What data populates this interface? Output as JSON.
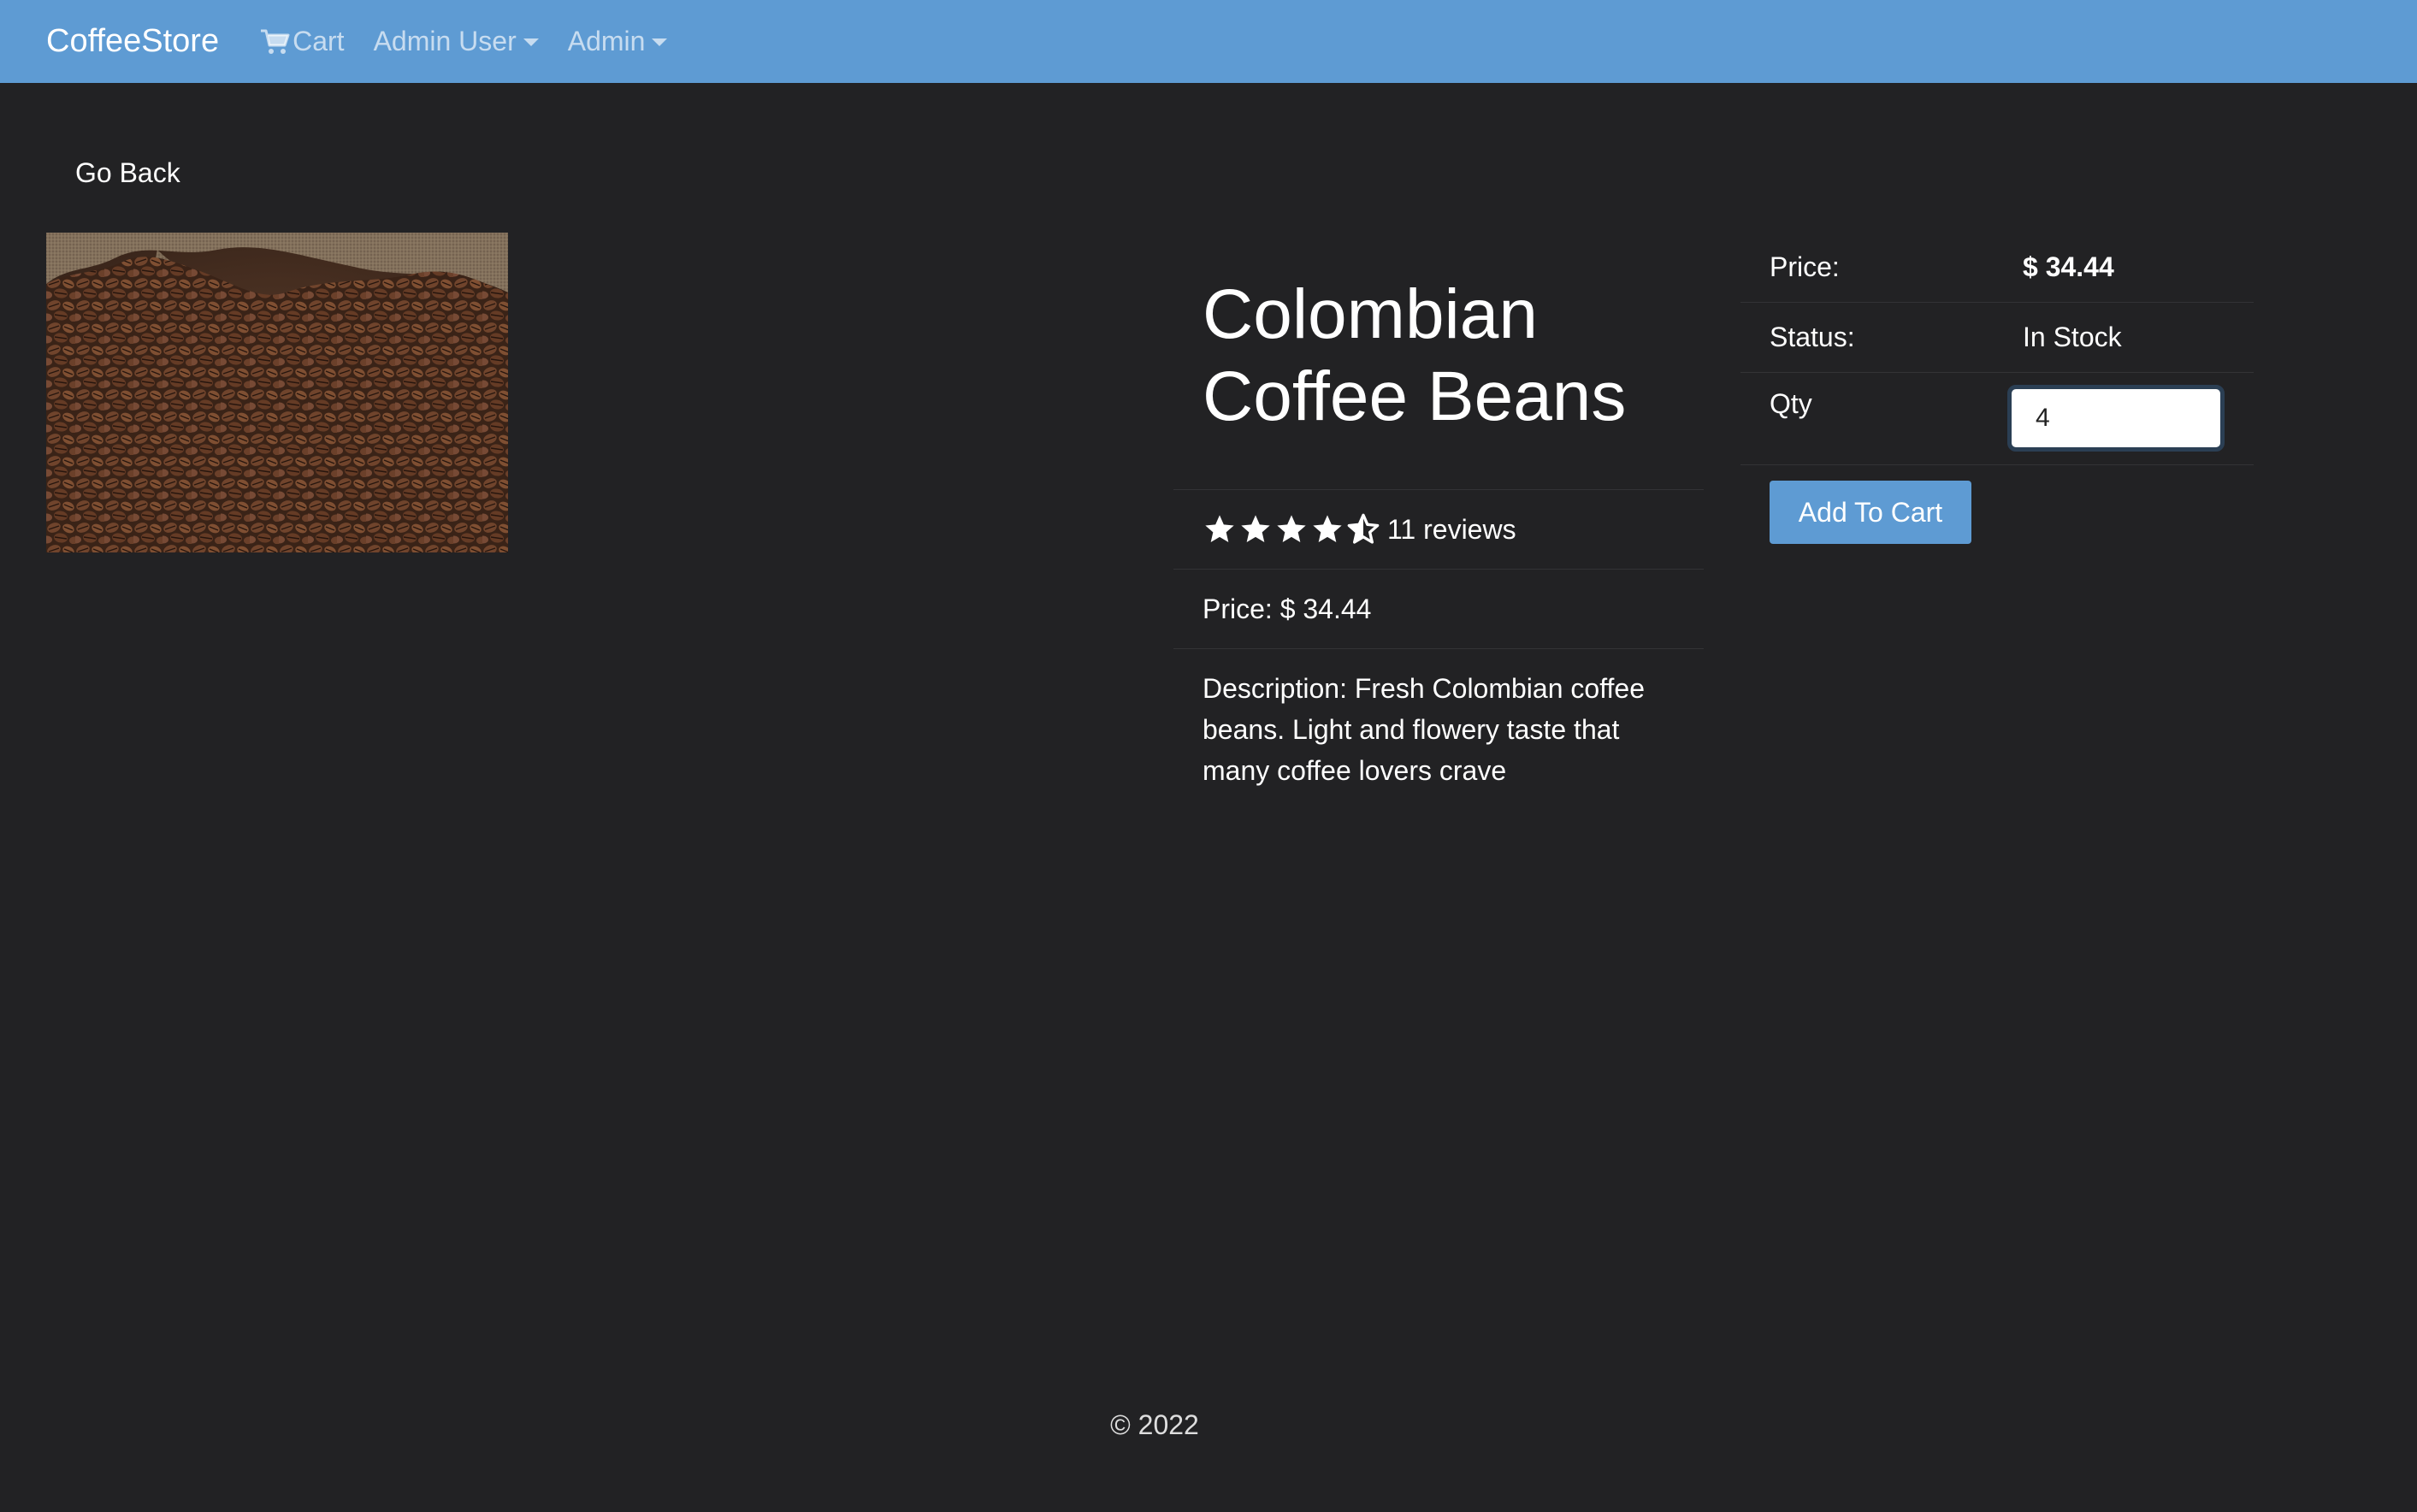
{
  "navbar": {
    "brand": "CoffeeStore",
    "cart_label": "Cart",
    "user_menu_label": "Admin User",
    "admin_menu_label": "Admin",
    "accent_color": "#5e9bd3"
  },
  "page": {
    "go_back_label": "Go Back",
    "background_color": "#222224"
  },
  "product": {
    "image_alt": "Colombian Coffee Beans",
    "name": "Colombian Coffee Beans",
    "rating": 4.5,
    "reviews_text": "11 reviews",
    "price_text": "Price: $ 34.44",
    "description_text": "Description: Fresh Colombian coffee beans. Light and flowery taste that many coffee lovers crave"
  },
  "purchase": {
    "price_label": "Price:",
    "price_value": "$ 34.44",
    "status_label": "Status:",
    "status_value": "In Stock",
    "qty_label": "Qty",
    "qty_value": "4",
    "add_to_cart_label": "Add To Cart"
  },
  "footer": {
    "copyright": "© 2022"
  }
}
